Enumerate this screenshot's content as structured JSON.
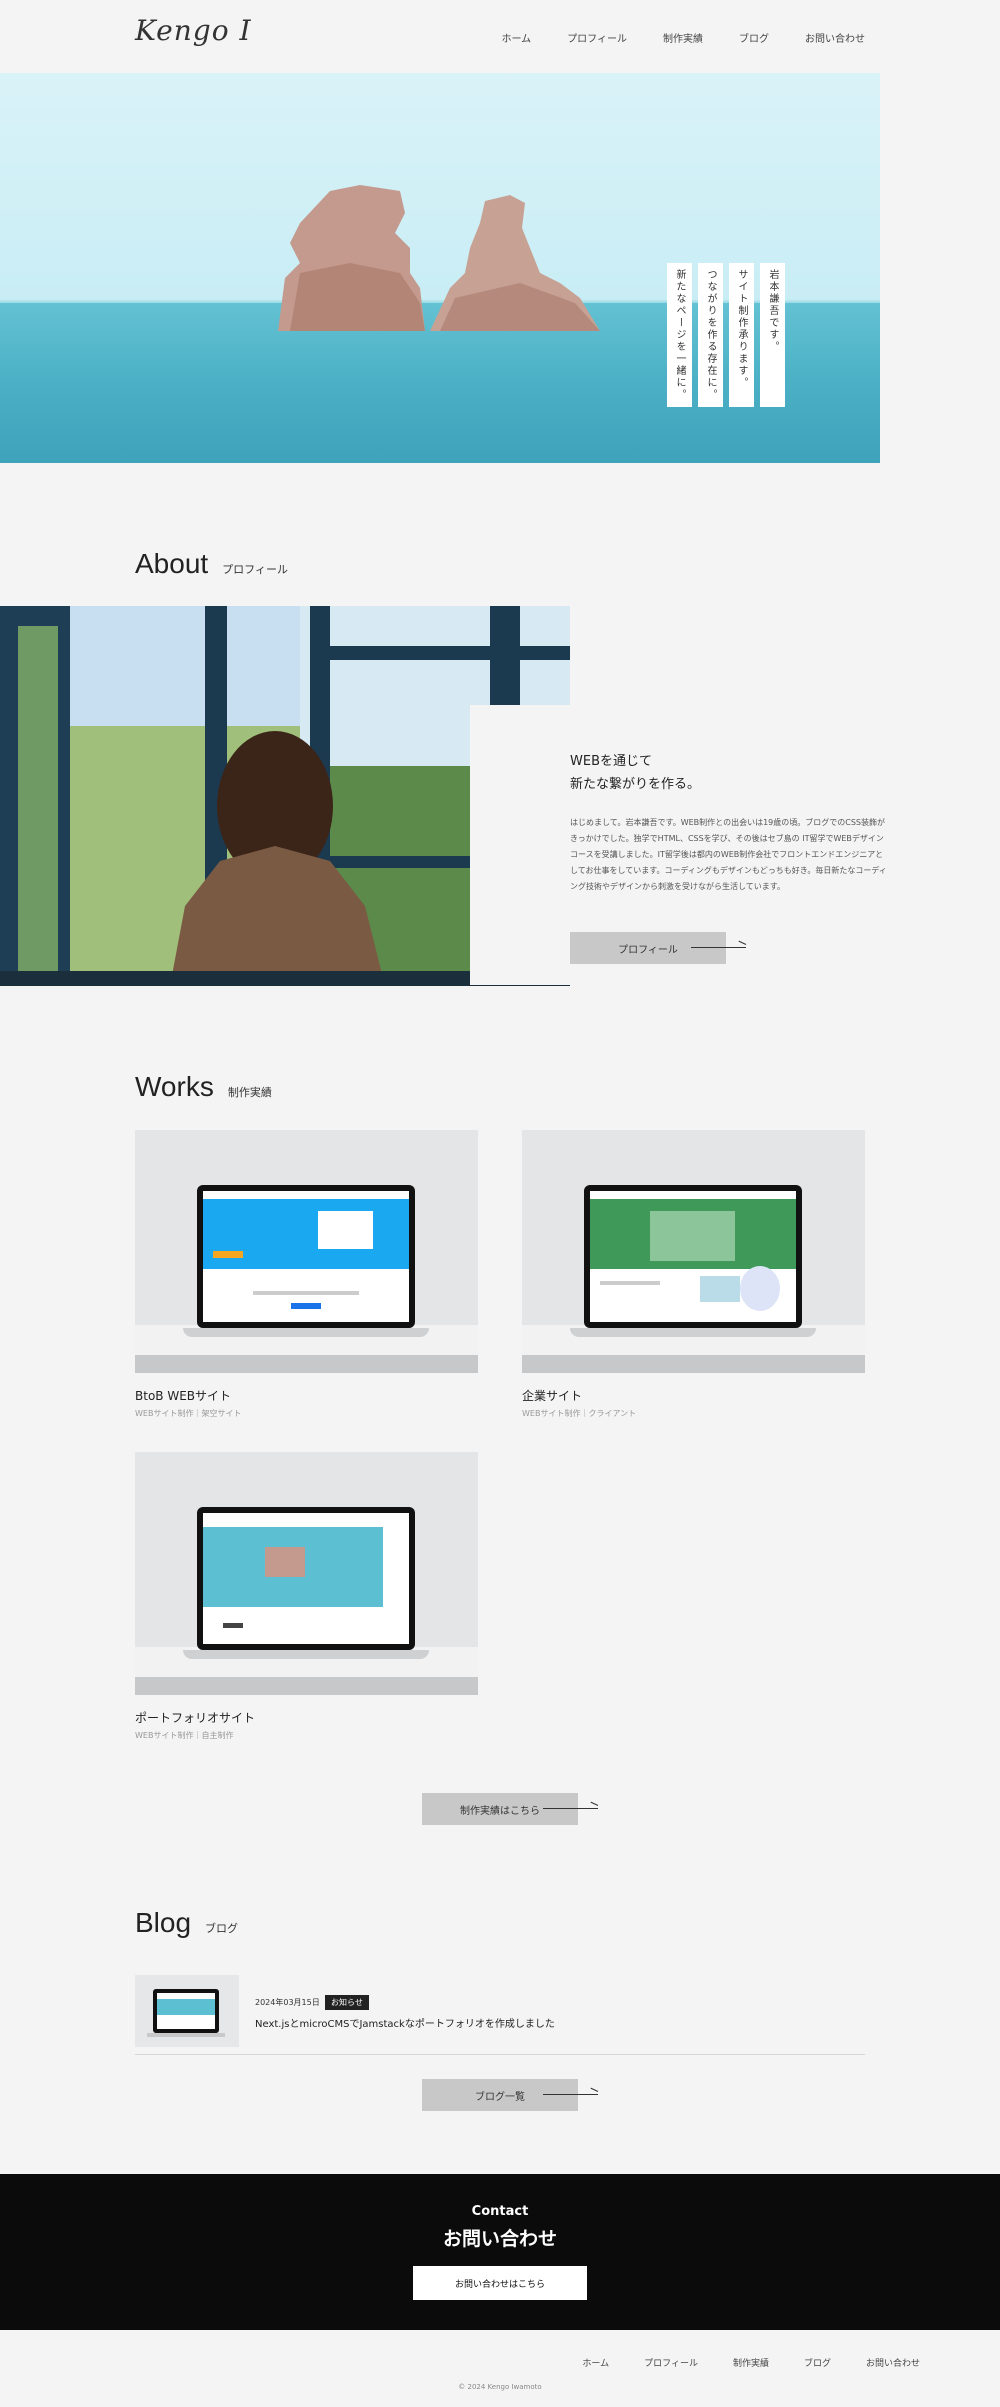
{
  "header": {
    "logo": "Kengo I",
    "nav": [
      "ホーム",
      "プロフィール",
      "制作実績",
      "ブログ",
      "お問い合わせ"
    ]
  },
  "hero": {
    "tagline": [
      "岩本謙吾です。",
      "サイト制作承ります。",
      "つながりを作る存在に。",
      "新たなページを一緒に。"
    ]
  },
  "about": {
    "title_en": "About",
    "title_ja": "プロフィール",
    "heading_line1": "WEBを通じて",
    "heading_line2": "新たな繋がりを作る。",
    "body": "はじめまして。岩本謙吾です。WEB制作との出会いは19歳の頃。ブログでのCSS装飾がきっかけでした。独学でHTML、CSSを学び、その後はセブ島の IT留学でWEBデザインコースを受講しました。IT留学後は都内のWEB制作会社でフロントエンドエンジニアとしてお仕事をしています。コーディングもデザインもどっちも好き。毎日新たなコーディング技術やデザインから刺激を受けながら生活しています。",
    "button": "プロフィール"
  },
  "works": {
    "title_en": "Works",
    "title_ja": "制作実績",
    "items": [
      {
        "title": "BtoB WEBサイト",
        "meta": "WEBサイト制作｜架空サイト"
      },
      {
        "title": "企業サイト",
        "meta": "WEBサイト制作｜クライアント"
      },
      {
        "title": "ポートフォリオサイト",
        "meta": "WEBサイト制作｜自主制作"
      }
    ],
    "button": "制作実績はこちら"
  },
  "blog": {
    "title_en": "Blog",
    "title_ja": "ブログ",
    "post": {
      "date": "2024年03月15日",
      "badge": "お知らせ",
      "title": "Next.jsとmicroCMSでJamstackなポートフォリオを作成しました"
    },
    "button": "ブログ一覧"
  },
  "contact": {
    "title_en": "Contact",
    "title_ja": "お問い合わせ",
    "button": "お問い合わせはこちら"
  },
  "footer": {
    "nav": [
      "ホーム",
      "プロフィール",
      "制作実績",
      "ブログ",
      "お問い合わせ"
    ],
    "copyright": "© 2024 Kengo Iwamoto"
  },
  "colors": {
    "background": "#f4f4f4",
    "button": "#c8c8c8",
    "contact_bg": "#0b0b0b",
    "sea": "#4bb0c5"
  }
}
